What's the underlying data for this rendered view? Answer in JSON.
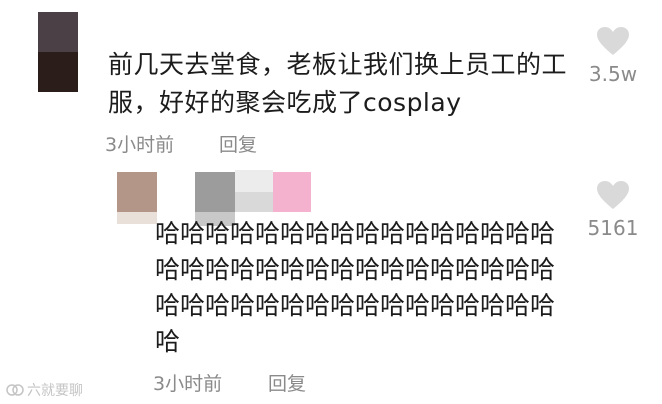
{
  "comment": {
    "text": "前几天去堂食，老板让我们换上员工的工服，好好的聚会吃成了cosplay",
    "time": "3小时前",
    "reply_label": "回复",
    "likes": "3.5w"
  },
  "reply": {
    "text": "哈哈哈哈哈哈哈哈哈哈哈哈哈哈哈哈哈哈哈哈哈哈哈哈哈哈哈哈哈哈哈哈哈哈哈哈哈哈哈哈哈哈哈哈哈哈哈哈哈",
    "time": "3小时前",
    "reply_label": "回复",
    "likes": "5161"
  },
  "watermark": {
    "text": "六就要聊"
  },
  "colors": {
    "heart": "#d9d9d9",
    "meta_text": "#8a8a8a"
  }
}
